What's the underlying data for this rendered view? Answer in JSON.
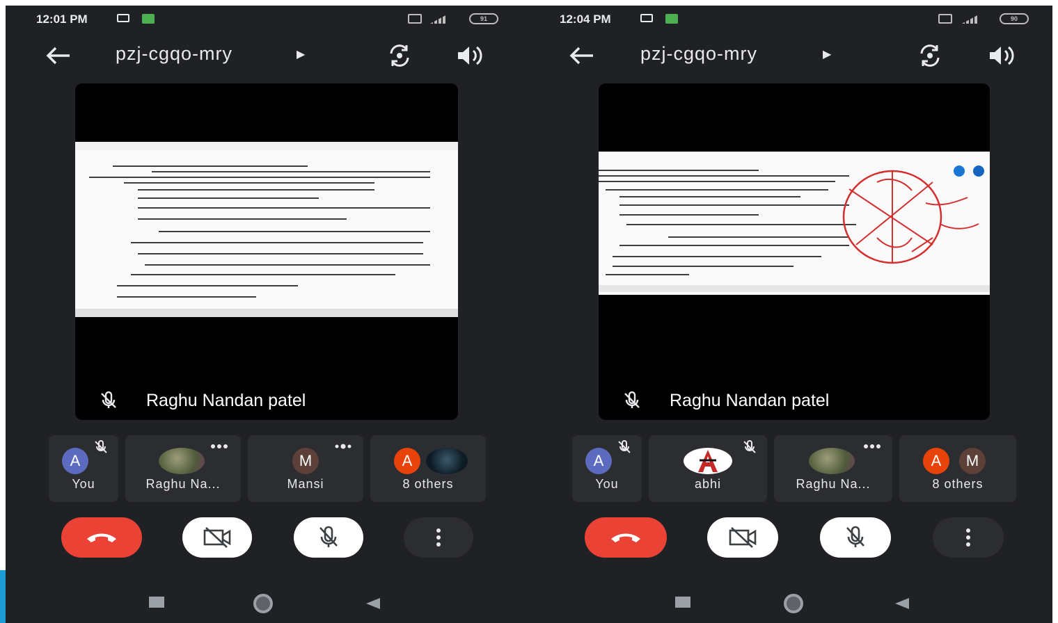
{
  "colors": {
    "background": "#202124",
    "tile": "#2c2d30",
    "end_call": "#ea4335",
    "avatar_blue": "#5c6bc0",
    "avatar_orange": "#e8430a",
    "avatar_brown": "#5d4037",
    "annotation_red": "#d32f2f"
  },
  "screens": [
    {
      "status": {
        "time": "12:01 PM",
        "battery": "91"
      },
      "meeting": {
        "code": "pzj-cgqo-mry"
      },
      "main_tile": {
        "name": "Raghu Nandan patel"
      },
      "participants": [
        {
          "label": "You",
          "initial": "A"
        },
        {
          "label": "Raghu Na..."
        },
        {
          "label": "Mansi",
          "initial": "M"
        },
        {
          "label": "8 others",
          "initial": "A"
        }
      ]
    },
    {
      "status": {
        "time": "12:04 PM",
        "battery": "90"
      },
      "meeting": {
        "code": "pzj-cgqo-mry"
      },
      "main_tile": {
        "name": "Raghu Nandan patel"
      },
      "participants": [
        {
          "label": "You",
          "initial": "A"
        },
        {
          "label": "abhi"
        },
        {
          "label": "Raghu Na..."
        },
        {
          "label": "8 others",
          "initial": "A",
          "initial2": "M"
        }
      ]
    }
  ],
  "icons": {
    "back": "arrow-left-icon",
    "code_menu": "triangle-right-icon",
    "switch_camera": "switch-camera-icon",
    "speaker": "speaker-icon",
    "mic_off": "mic-off-icon",
    "camera_off": "camera-off-icon",
    "end_call": "phone-hangup-icon",
    "more": "more-vertical-icon",
    "nav_recents": "nav-square-icon",
    "nav_home": "nav-circle-icon",
    "nav_back": "nav-triangle-icon"
  }
}
